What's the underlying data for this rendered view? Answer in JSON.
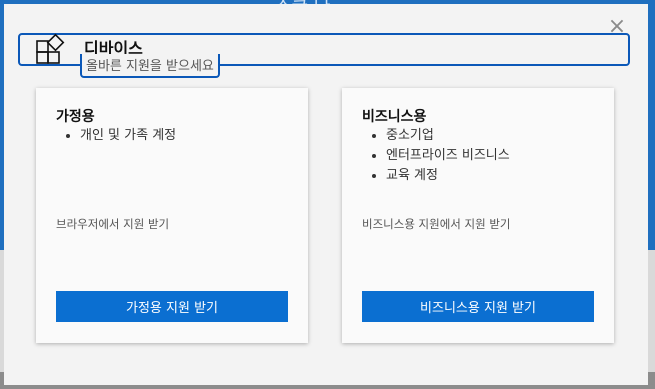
{
  "background": {
    "partial_text": "스쿨 나"
  },
  "modal": {
    "close_icon": "×",
    "header": {
      "title": "디바이스",
      "subtitle": "올바른 지원을 받으세요"
    },
    "cards": [
      {
        "title": "가정용",
        "items": [
          "개인 및 가족 계정"
        ],
        "description": "브라우저에서 지원 받기",
        "button_label": "가정용 지원 받기"
      },
      {
        "title": "비즈니스용",
        "items": [
          "중소기업",
          "엔터프라이즈 비즈니스",
          "교육 계정"
        ],
        "description": "비즈니스용 지원에서 지원 받기",
        "button_label": "비즈니스용 지원 받기"
      }
    ]
  },
  "colors": {
    "accent": "#0b6fd1",
    "focus_border": "#0b58b8",
    "page_background": "#1f6fbf"
  }
}
